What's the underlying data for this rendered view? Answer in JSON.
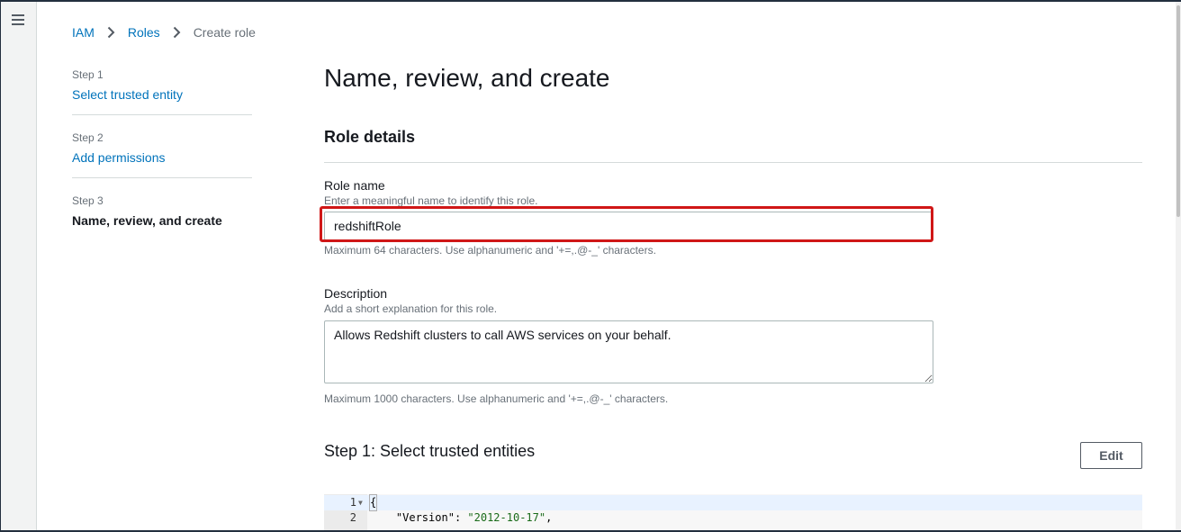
{
  "breadcrumb": {
    "items": [
      {
        "label": "IAM"
      },
      {
        "label": "Roles"
      }
    ],
    "current": "Create role"
  },
  "wizard": {
    "steps": [
      {
        "number": "Step 1",
        "title": "Select trusted entity"
      },
      {
        "number": "Step 2",
        "title": "Add permissions"
      },
      {
        "number": "Step 3",
        "title": "Name, review, and create"
      }
    ]
  },
  "main": {
    "page_title": "Name, review, and create",
    "section_title": "Role details",
    "role_name": {
      "label": "Role name",
      "hint": "Enter a meaningful name to identify this role.",
      "value": "redshiftRole",
      "constraint": "Maximum 64 characters. Use alphanumeric and '+=,.@-_' characters."
    },
    "description": {
      "label": "Description",
      "hint": "Add a short explanation for this role.",
      "value": "Allows Redshift clusters to call AWS services on your behalf.",
      "constraint": "Maximum 1000 characters. Use alphanumeric and '+=,.@-_' characters."
    },
    "trusted_entities": {
      "title": "Step 1: Select trusted entities",
      "edit_label": "Edit"
    },
    "policy_code": {
      "lines": [
        {
          "num": "1",
          "text": "{"
        },
        {
          "num": "2",
          "key": "\"Version\"",
          "value": "\"2012-10-17\""
        }
      ]
    }
  },
  "colors": {
    "link": "#0073bb",
    "highlight": "#d01717",
    "nav_dark": "#232f3e"
  }
}
